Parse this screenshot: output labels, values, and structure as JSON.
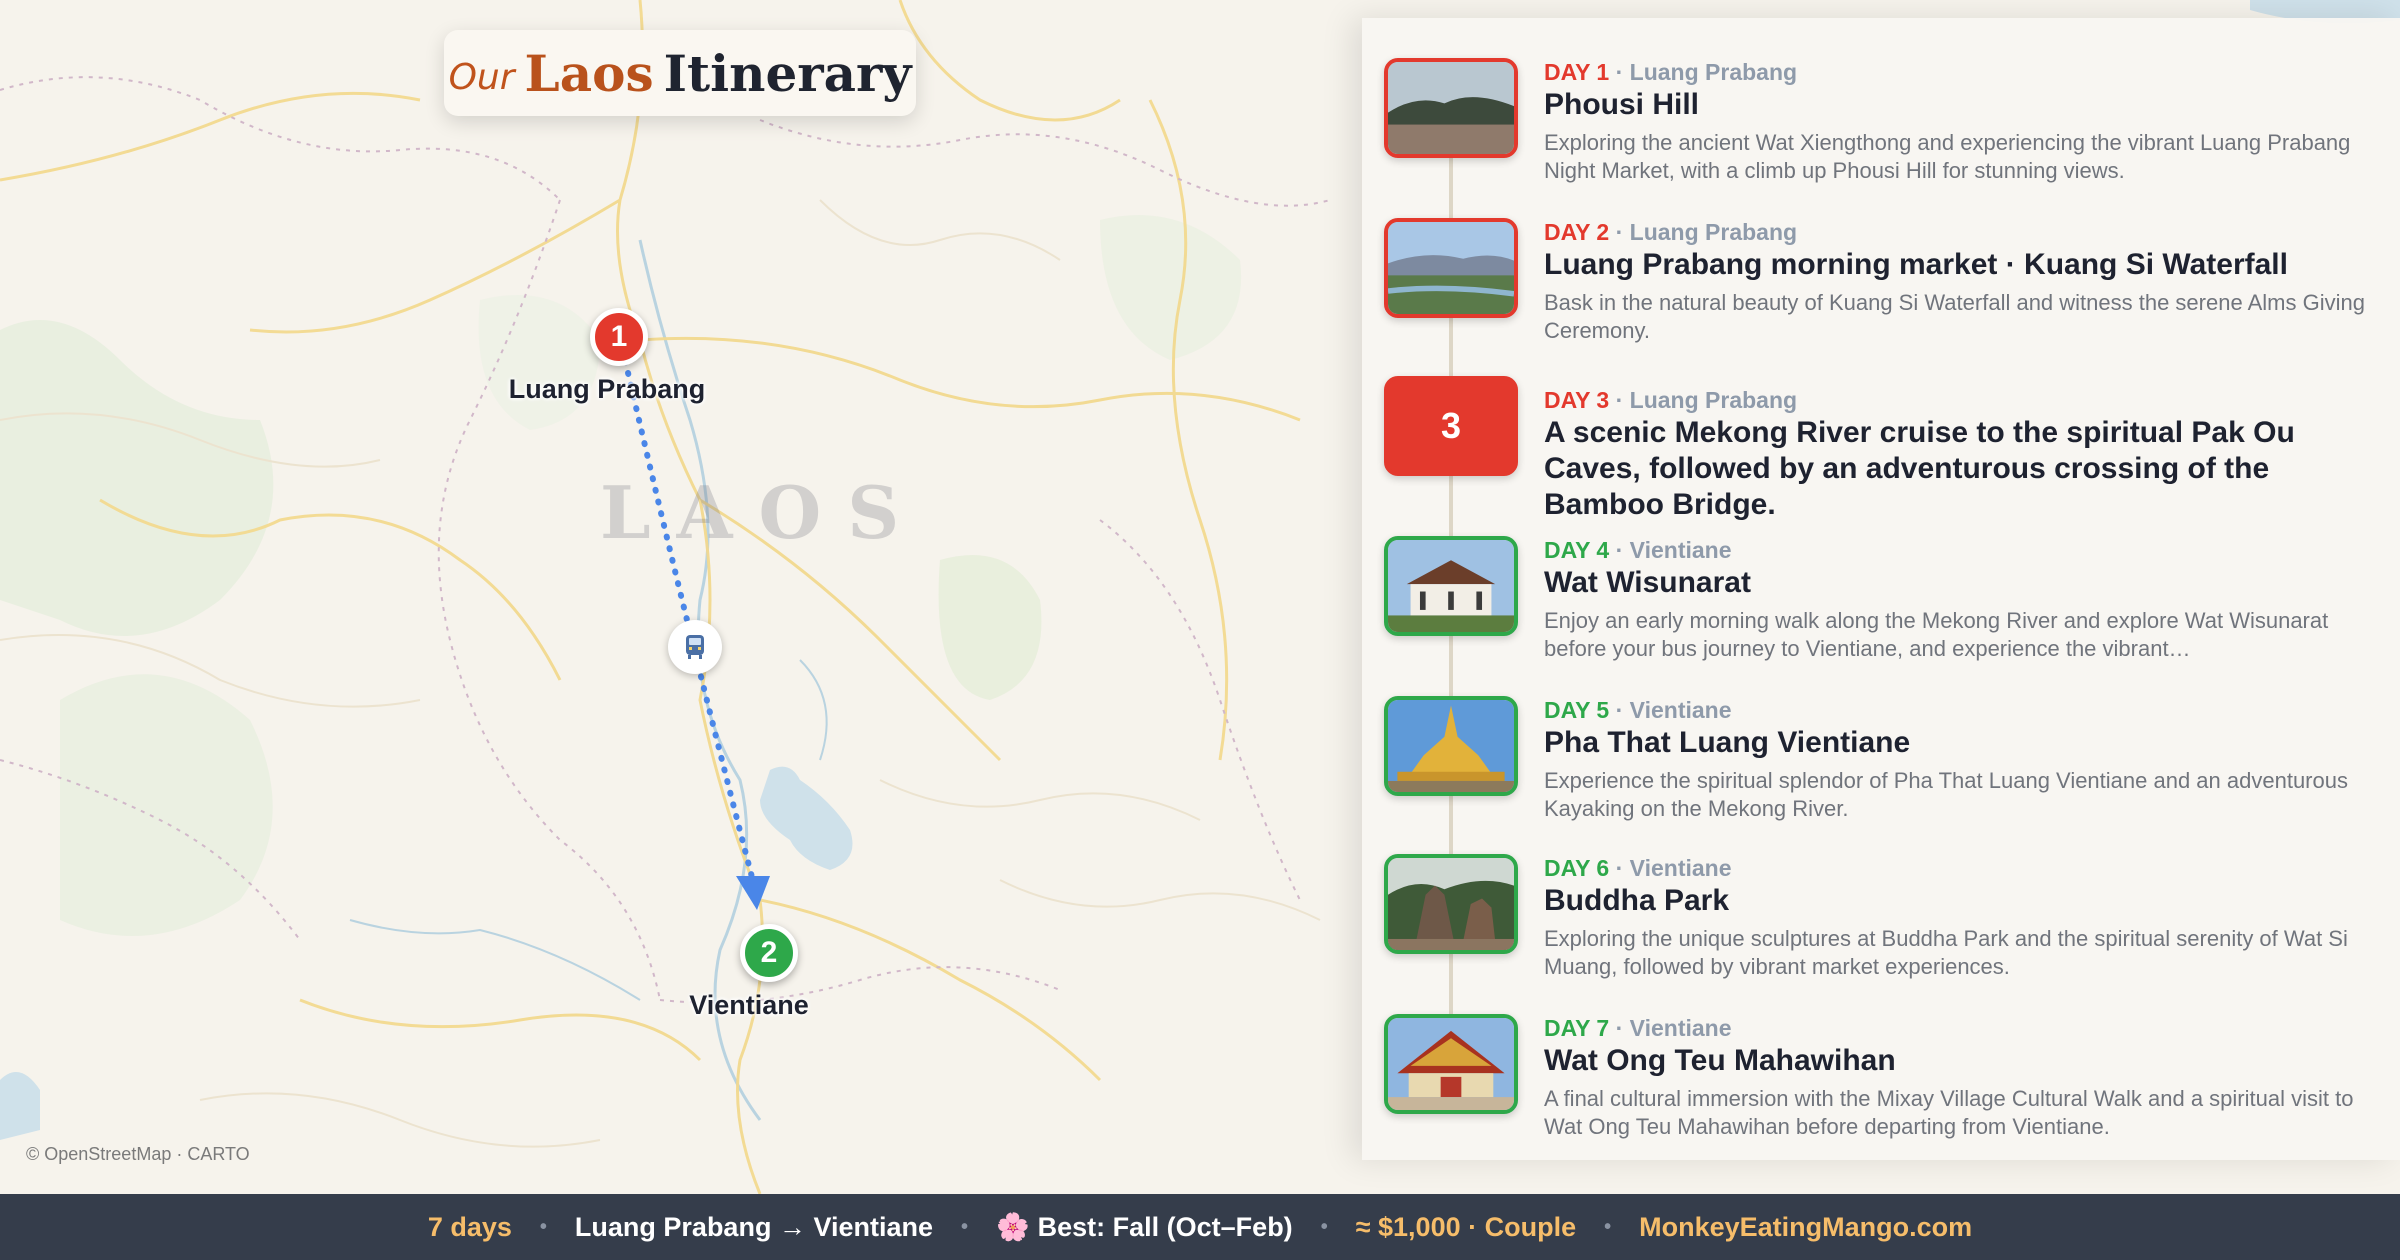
{
  "map": {
    "title": {
      "our": "Our",
      "country": "Laos",
      "word": "Itinerary"
    },
    "country_label": "LAOS",
    "attribution": "© OpenStreetMap · CARTO",
    "stops": [
      {
        "number": "1",
        "city": "Luang Prabang",
        "color": "#e3392d"
      },
      {
        "number": "2",
        "city": "Vientiane",
        "color": "#2ea84a"
      }
    ],
    "route": {
      "mode_icon": "bus-icon",
      "color": "#4a86e8",
      "style": "dotted"
    }
  },
  "panel": {
    "days": [
      {
        "label": "DAY 1",
        "sep": " · ",
        "location": "Luang Prabang",
        "title": "Phousi Hill",
        "desc": "Exploring the ancient Wat Xiengthong and experiencing the vibrant Luang Prabang Night Market, with a climb up Phousi Hill for stunning views."
      },
      {
        "label": "DAY 2",
        "sep": " · ",
        "location": "Luang Prabang",
        "title": "Luang Prabang morning market · Kuang Si Waterfall",
        "desc": "Bask in the natural beauty of Kuang Si Waterfall and witness the serene Alms Giving Ceremony."
      },
      {
        "label": "DAY 3",
        "sep": " · ",
        "location": "Luang Prabang",
        "number": "3",
        "title": "A scenic Mekong River cruise to the spiritual Pak Ou Caves, followed by an adventurous crossing of the Bamboo Bridge.",
        "desc": ""
      },
      {
        "label": "DAY 4",
        "sep": " · ",
        "location": "Vientiane",
        "title": "Wat Wisunarat",
        "desc": "Enjoy an early morning walk along the Mekong River and explore Wat Wisunarat before your bus journey to Vientiane, and experience the vibrant…"
      },
      {
        "label": "DAY 5",
        "sep": " · ",
        "location": "Vientiane",
        "title": "Pha That Luang Vientiane",
        "desc": "Experience the spiritual splendor of Pha That Luang Vientiane and an adventurous Kayaking on the Mekong River."
      },
      {
        "label": "DAY 6",
        "sep": " · ",
        "location": "Vientiane",
        "title": "Buddha Park",
        "desc": "Exploring the unique sculptures at Buddha Park and the spiritual serenity of Wat Si Muang, followed by vibrant market experiences."
      },
      {
        "label": "DAY 7",
        "sep": " · ",
        "location": "Vientiane",
        "title": "Wat Ong Teu Mahawihan",
        "desc": "A final cultural immersion with the Mixay Village Cultural Walk and a spiritual visit to Wat Ong Teu Mahawihan before departing from Vientiane."
      }
    ]
  },
  "footer": {
    "duration": "7 days",
    "route": "Luang Prabang → Vientiane",
    "season_icon": "🌸",
    "season": "Best: Fall (Oct–Feb)",
    "budget": "≈ $1,000 · Couple",
    "site": "MonkeyEatingMango.com",
    "separator": "•"
  },
  "colors": {
    "red": "#e3392d",
    "green": "#2ea84a",
    "footer_bg": "#353d4b",
    "footer_accent": "#f6bd6a",
    "route_blue": "#4a86e8"
  }
}
